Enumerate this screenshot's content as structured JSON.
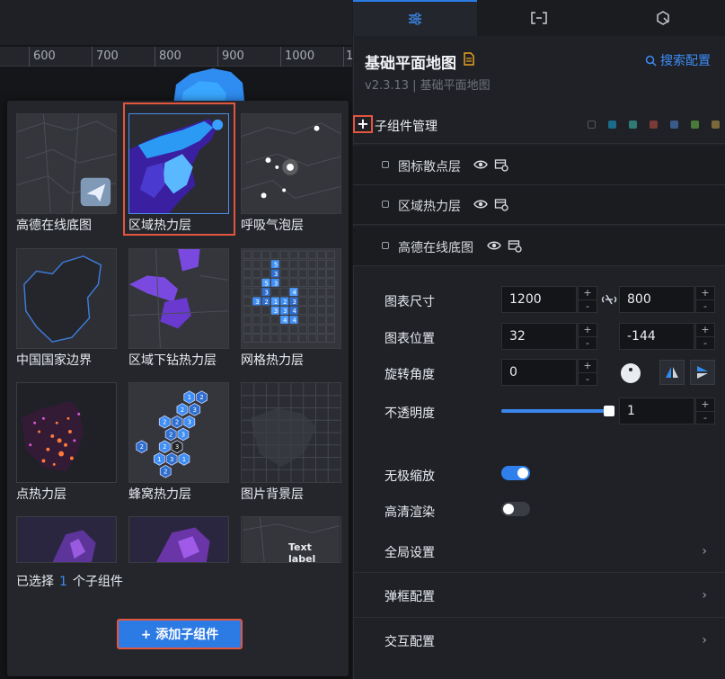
{
  "ruler": {
    "marks": [
      "600",
      "700",
      "800",
      "900",
      "1000",
      "1"
    ]
  },
  "popup": {
    "components": [
      {
        "label": "高德在线底图",
        "icon": "amap-logo-icon"
      },
      {
        "label": "区域热力层",
        "icon": "region-heat-icon"
      },
      {
        "label": "呼吸气泡层",
        "icon": "bubble-icon"
      },
      {
        "label": "中国国家边界",
        "icon": "border-icon"
      },
      {
        "label": "区域下钻热力层",
        "icon": "drill-heat-icon"
      },
      {
        "label": "网格热力层",
        "icon": "grid-heat-icon"
      },
      {
        "label": "点热力层",
        "icon": "point-heat-icon"
      },
      {
        "label": "蜂窝热力层",
        "icon": "hex-heat-icon"
      },
      {
        "label": "图片背景层",
        "icon": "image-bg-icon"
      },
      {
        "label": "",
        "icon": "purple-map-icon"
      },
      {
        "label": "",
        "icon": "purple-map-icon"
      },
      {
        "label": "Text label",
        "icon": "text-label-icon"
      }
    ],
    "grid_numbers": [
      "5",
      "3",
      "5",
      "3",
      "3",
      "4",
      "3",
      "2",
      "1",
      "2",
      "3",
      "3",
      "3",
      "4",
      "4",
      "4"
    ],
    "hex_numbers": [
      "1",
      "2",
      "2",
      "3",
      "2",
      "2",
      "3",
      "2",
      "3",
      "2",
      "2",
      "3",
      "1",
      "3",
      "1",
      "2"
    ],
    "selected_prefix": "已选择",
    "selected_count": "1",
    "selected_suffix": "个子组件",
    "add_button": "+ 添加子组件"
  },
  "panel": {
    "title": "基础平面地图",
    "version": "v2.3.13 | 基础平面地图",
    "search_config": "搜索配置",
    "child_manage": "子组件管理",
    "plus": "+",
    "colors": [
      "#2b2d33",
      "#1b6b8a",
      "#2f7a74",
      "#7a3a3a",
      "#3a5a8a",
      "#4a7a3a",
      "#7a6a3a"
    ],
    "layers": [
      {
        "name": "图标散点层"
      },
      {
        "name": "区域热力层"
      },
      {
        "name": "高德在线底图"
      }
    ],
    "props": {
      "size_label": "图表尺寸",
      "width": "1200",
      "height": "800",
      "pos_label": "图表位置",
      "x": "32",
      "y": "-144",
      "rotate_label": "旋转角度",
      "rotate": "0",
      "opacity_label": "不透明度",
      "opacity": "1",
      "opacity_fraction": 1.0,
      "zoom_label": "无极缩放",
      "zoom_on": true,
      "hd_label": "高清渲染",
      "hd_on": false,
      "stepper_plus": "+",
      "stepper_minus": "-"
    },
    "sections": [
      "全局设置",
      "弹框配置",
      "交互配置"
    ]
  },
  "accent": "#2c7be5",
  "highlight": "#e2563e"
}
